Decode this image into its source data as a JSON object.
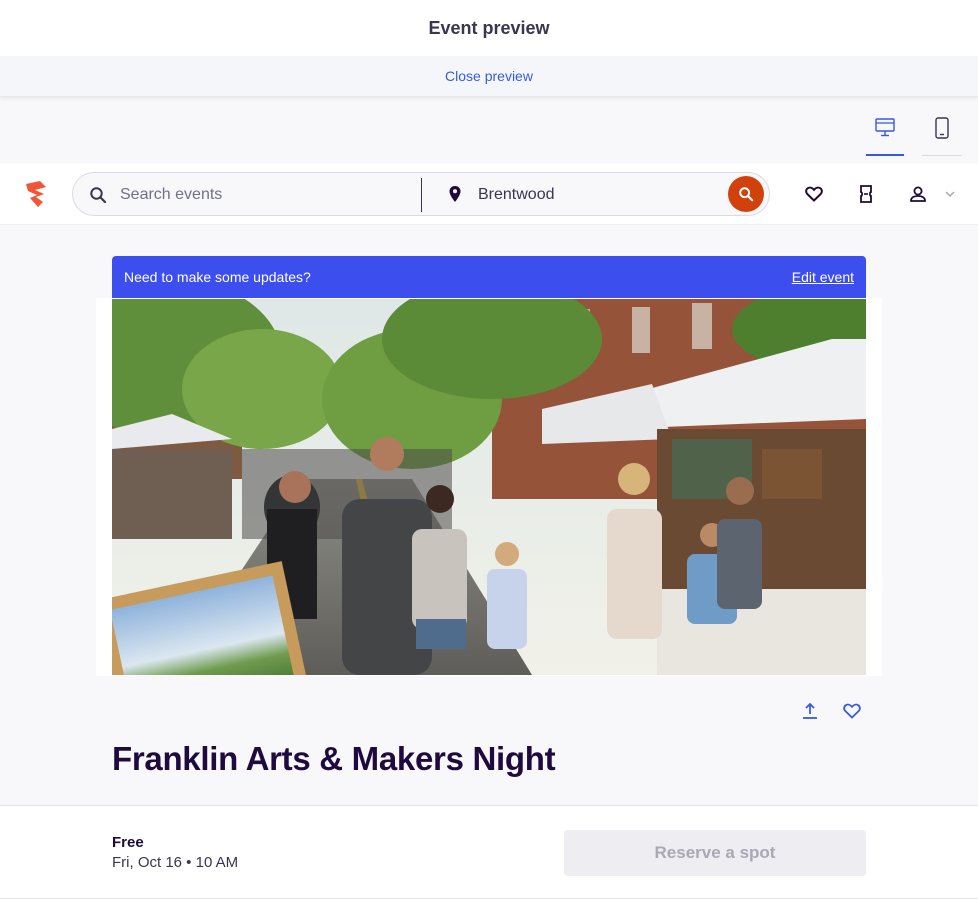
{
  "preview_header": {
    "title": "Event preview",
    "close_label": "Close preview"
  },
  "device_toggle": {
    "options": [
      "desktop-monitor-icon",
      "mobile-phone-icon"
    ],
    "active": "desktop",
    "accent": "#3659e3"
  },
  "navbar": {
    "logo": "eventbrite-logo",
    "search": {
      "placeholder": "Search events",
      "value": ""
    },
    "location": {
      "value": "Brentwood"
    },
    "brand_color": "#d1410c",
    "icons": [
      "heart-icon",
      "ticket-icon",
      "user-icon",
      "chevron-down-icon"
    ]
  },
  "banner": {
    "text": "Need to make some updates?",
    "link": "Edit event",
    "color": "#3d4eef"
  },
  "hero": {
    "alt": "Street art fair with vendor tents and crowds walking along a tree-lined downtown street"
  },
  "event": {
    "title": "Franklin Arts & Makers Night"
  },
  "footer": {
    "price": "Free",
    "date": "Fri, Oct 16 • 10 AM",
    "button": "Reserve a spot"
  }
}
